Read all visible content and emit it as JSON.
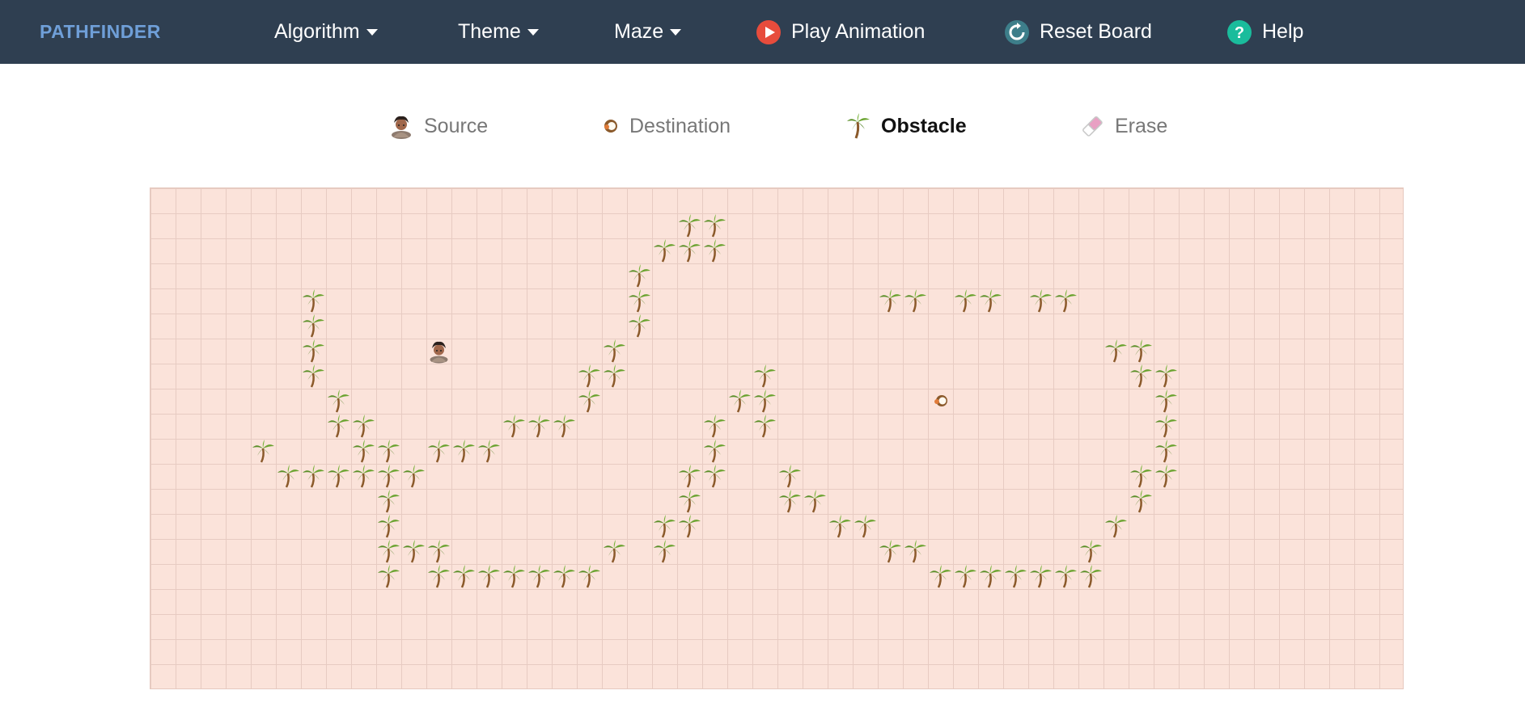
{
  "navbar": {
    "brand": "PATHFINDER",
    "items": [
      {
        "label": "Algorithm",
        "icon": "caret-down-icon"
      },
      {
        "label": "Theme",
        "icon": "caret-down-icon"
      },
      {
        "label": "Maze",
        "icon": "caret-down-icon"
      },
      {
        "label": "Play Animation",
        "icon": "play-icon",
        "icon_color": "#e74c3c"
      },
      {
        "label": "Reset Board",
        "icon": "refresh-icon",
        "icon_color": "#3d7e8a"
      },
      {
        "label": "Help",
        "icon": "help-icon",
        "icon_color": "#1abc9c"
      }
    ]
  },
  "legend": {
    "items": [
      {
        "label": "Source",
        "icon": "person-icon"
      },
      {
        "label": "Destination",
        "icon": "coconut-icon"
      },
      {
        "label": "Obstacle",
        "icon": "palm-tree-icon",
        "active": true
      },
      {
        "label": "Erase",
        "icon": "eraser-icon"
      }
    ]
  },
  "grid": {
    "cols": 50,
    "rows": 20,
    "cell_color": "#fbe3da",
    "source": [
      11,
      6
    ],
    "destination": [
      31,
      8
    ],
    "obstacles": [
      [
        21,
        1
      ],
      [
        22,
        1
      ],
      [
        20,
        2
      ],
      [
        21,
        2
      ],
      [
        22,
        2
      ],
      [
        19,
        3
      ],
      [
        6,
        4
      ],
      [
        19,
        4
      ],
      [
        29,
        4
      ],
      [
        30,
        4
      ],
      [
        32,
        4
      ],
      [
        33,
        4
      ],
      [
        35,
        4
      ],
      [
        36,
        4
      ],
      [
        6,
        5
      ],
      [
        19,
        5
      ],
      [
        6,
        6
      ],
      [
        18,
        6
      ],
      [
        38,
        6
      ],
      [
        39,
        6
      ],
      [
        6,
        7
      ],
      [
        17,
        7
      ],
      [
        18,
        7
      ],
      [
        24,
        7
      ],
      [
        39,
        7
      ],
      [
        40,
        7
      ],
      [
        7,
        8
      ],
      [
        17,
        8
      ],
      [
        23,
        8
      ],
      [
        24,
        8
      ],
      [
        40,
        8
      ],
      [
        7,
        9
      ],
      [
        8,
        9
      ],
      [
        14,
        9
      ],
      [
        15,
        9
      ],
      [
        16,
        9
      ],
      [
        22,
        9
      ],
      [
        24,
        9
      ],
      [
        40,
        9
      ],
      [
        4,
        10
      ],
      [
        8,
        10
      ],
      [
        9,
        10
      ],
      [
        11,
        10
      ],
      [
        12,
        10
      ],
      [
        13,
        10
      ],
      [
        22,
        10
      ],
      [
        40,
        10
      ],
      [
        5,
        11
      ],
      [
        6,
        11
      ],
      [
        7,
        11
      ],
      [
        8,
        11
      ],
      [
        9,
        11
      ],
      [
        10,
        11
      ],
      [
        21,
        11
      ],
      [
        22,
        11
      ],
      [
        25,
        11
      ],
      [
        39,
        11
      ],
      [
        40,
        11
      ],
      [
        9,
        12
      ],
      [
        21,
        12
      ],
      [
        25,
        12
      ],
      [
        26,
        12
      ],
      [
        39,
        12
      ],
      [
        9,
        13
      ],
      [
        20,
        13
      ],
      [
        21,
        13
      ],
      [
        27,
        13
      ],
      [
        28,
        13
      ],
      [
        38,
        13
      ],
      [
        9,
        14
      ],
      [
        10,
        14
      ],
      [
        11,
        14
      ],
      [
        18,
        14
      ],
      [
        20,
        14
      ],
      [
        29,
        14
      ],
      [
        30,
        14
      ],
      [
        37,
        14
      ],
      [
        9,
        15
      ],
      [
        11,
        15
      ],
      [
        12,
        15
      ],
      [
        13,
        15
      ],
      [
        14,
        15
      ],
      [
        15,
        15
      ],
      [
        16,
        15
      ],
      [
        17,
        15
      ],
      [
        31,
        15
      ],
      [
        32,
        15
      ],
      [
        33,
        15
      ],
      [
        34,
        15
      ],
      [
        35,
        15
      ],
      [
        36,
        15
      ],
      [
        37,
        15
      ]
    ]
  }
}
